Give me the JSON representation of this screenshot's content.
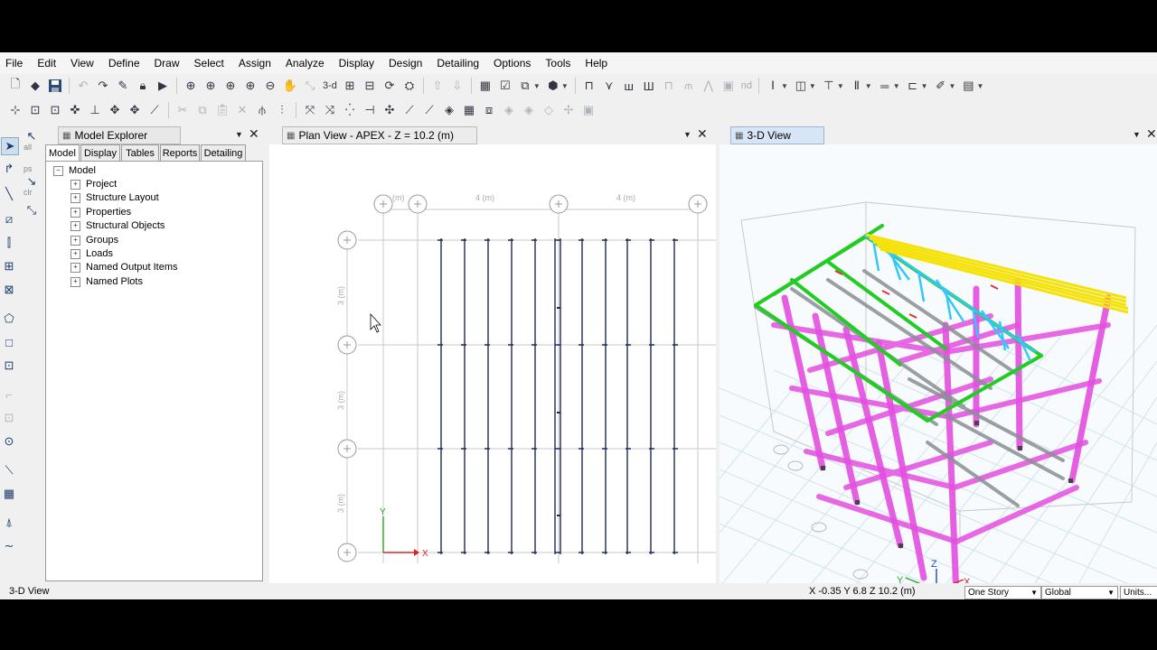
{
  "menu": [
    "File",
    "Edit",
    "View",
    "Define",
    "Draw",
    "Select",
    "Assign",
    "Analyze",
    "Display",
    "Design",
    "Detailing",
    "Options",
    "Tools",
    "Help"
  ],
  "toolbar": {
    "btn_3d": "3-d",
    "btn_nd": "nd"
  },
  "left_toolbar": {
    "all": "all",
    "ps": "ps",
    "clr": "clr"
  },
  "explorer": {
    "title": "Model Explorer",
    "tabs": [
      "Model",
      "Display",
      "Tables",
      "Reports",
      "Detailing"
    ],
    "root": "Model",
    "items": [
      "Project",
      "Structure Layout",
      "Properties",
      "Structural Objects",
      "Groups",
      "Loads",
      "Named Output Items",
      "Named Plots"
    ]
  },
  "plan_view": {
    "title": "Plan View - APEX - Z = 10.2 (m)",
    "dims_x": [
      "(m)",
      "4 (m)",
      "4 (m)"
    ],
    "dims_y": [
      "3 (m)",
      "3 (m)",
      "3 (m)"
    ],
    "axis_x": "X",
    "axis_y": "Y"
  },
  "view_3d": {
    "title": "3-D View",
    "axis_x": "X",
    "axis_y": "Y",
    "axis_z": "Z"
  },
  "status": {
    "left": "3-D View",
    "coords": "X -0.35  Y 6.8  Z 10.2 (m)",
    "story": "One Story",
    "system": "Global",
    "units": "Units..."
  },
  "colors": {
    "columns": "#e34fe0",
    "beams_green": "#22cc22",
    "truss_cyan": "#33c6ff",
    "roof_yellow": "#f5e20a",
    "purlins_gray": "#8a8f94",
    "plan_lines": "#1c2a55",
    "active_tab": "#d7e6f6"
  }
}
